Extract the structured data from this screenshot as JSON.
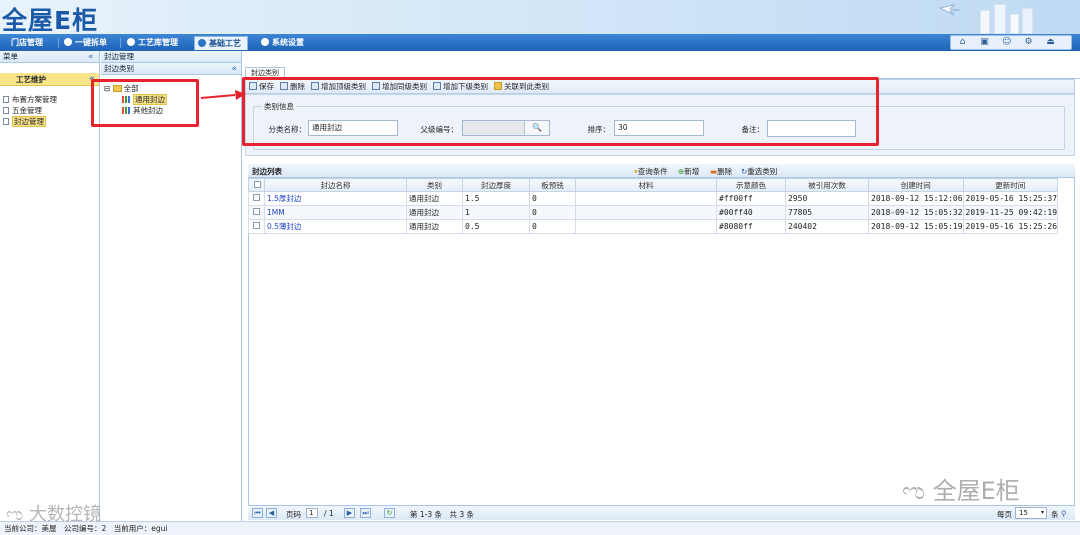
{
  "app": {
    "logo_text": "全屋E柜"
  },
  "nav": {
    "tabs": [
      {
        "label": "门店管理",
        "active": false
      },
      {
        "label": "一键拆单",
        "active": false
      },
      {
        "label": "工艺库管理",
        "active": false
      },
      {
        "label": "基础工艺",
        "active": true
      },
      {
        "label": "系统设置",
        "active": false
      }
    ],
    "tool_icons": [
      "home-icon",
      "calendar-icon",
      "user-icon",
      "gear-icon",
      "logout-icon"
    ]
  },
  "left_menu": {
    "header": "菜单",
    "active_group": "工艺维护",
    "items": [
      {
        "label": "布置方案管理",
        "selected": false
      },
      {
        "label": "五金管理",
        "selected": false
      },
      {
        "label": "封边管理",
        "selected": true
      }
    ]
  },
  "breadcrumb": "封边管理",
  "tree_panel": {
    "header": "封边类别",
    "root": "全部",
    "children": [
      {
        "label": "通用封边",
        "selected": true
      },
      {
        "label": "其他封边",
        "selected": false
      }
    ]
  },
  "main_tab": "封边类别",
  "toolbar": {
    "save": "保存",
    "delete": "删除",
    "add_top": "增加顶级类别",
    "add_same": "增加同级类别",
    "add_child": "增加下级类别",
    "link": "关联到此类别"
  },
  "form": {
    "legend": "类别信息",
    "name_label": "分类名称：",
    "name_value": "通用封边",
    "parent_label": "父级编号：",
    "parent_value": "",
    "sort_label": "排序：",
    "sort_value": "30",
    "remark_label": "备注：",
    "remark_value": ""
  },
  "grid": {
    "title": "封边列表",
    "actions": {
      "query": "查询条件",
      "add": "新增",
      "delete": "删除",
      "reselect": "重选类别"
    },
    "columns": [
      "封边名称",
      "类别",
      "封边厚度",
      "板预铣",
      "材料",
      "示意颜色",
      "被引用次数",
      "创建时间",
      "更新时间"
    ],
    "rows": [
      {
        "name": "1.5厚封边",
        "category": "通用封边",
        "thickness": "1.5",
        "premill": "0",
        "material": "",
        "color": "#ff00ff",
        "refs": "2950",
        "created": "2018-09-12 15:12:06",
        "updated": "2019-05-16 15:25:37"
      },
      {
        "name": "1MM",
        "category": "通用封边",
        "thickness": "1",
        "premill": "0",
        "material": "",
        "color": "#00ff40",
        "refs": "77805",
        "created": "2018-09-12 15:05:32",
        "updated": "2019-11-25 09:42:19"
      },
      {
        "name": "0.5薄封边",
        "category": "通用封边",
        "thickness": "0.5",
        "premill": "0",
        "material": "",
        "color": "#8080ff",
        "refs": "240402",
        "created": "2018-09-12 15:05:19",
        "updated": "2019-05-16 15:25:26"
      }
    ]
  },
  "pager": {
    "page_label": "页码",
    "page_value": "1",
    "page_total": "/ 1",
    "summary": "第 1-3 条　共 3 条",
    "per_page_label": "每页",
    "per_page_value": "15",
    "per_page_unit": "条"
  },
  "status_bar": "当前公司：美屋　公司编号：2　当前用户：egui",
  "watermarks": {
    "left": "大数控镜",
    "right": "全屋E柜"
  },
  "colors": {
    "nav": "#1e62b6",
    "highlight": "#f7e38a",
    "annotation": "#e6232e",
    "link": "#2146c5"
  }
}
